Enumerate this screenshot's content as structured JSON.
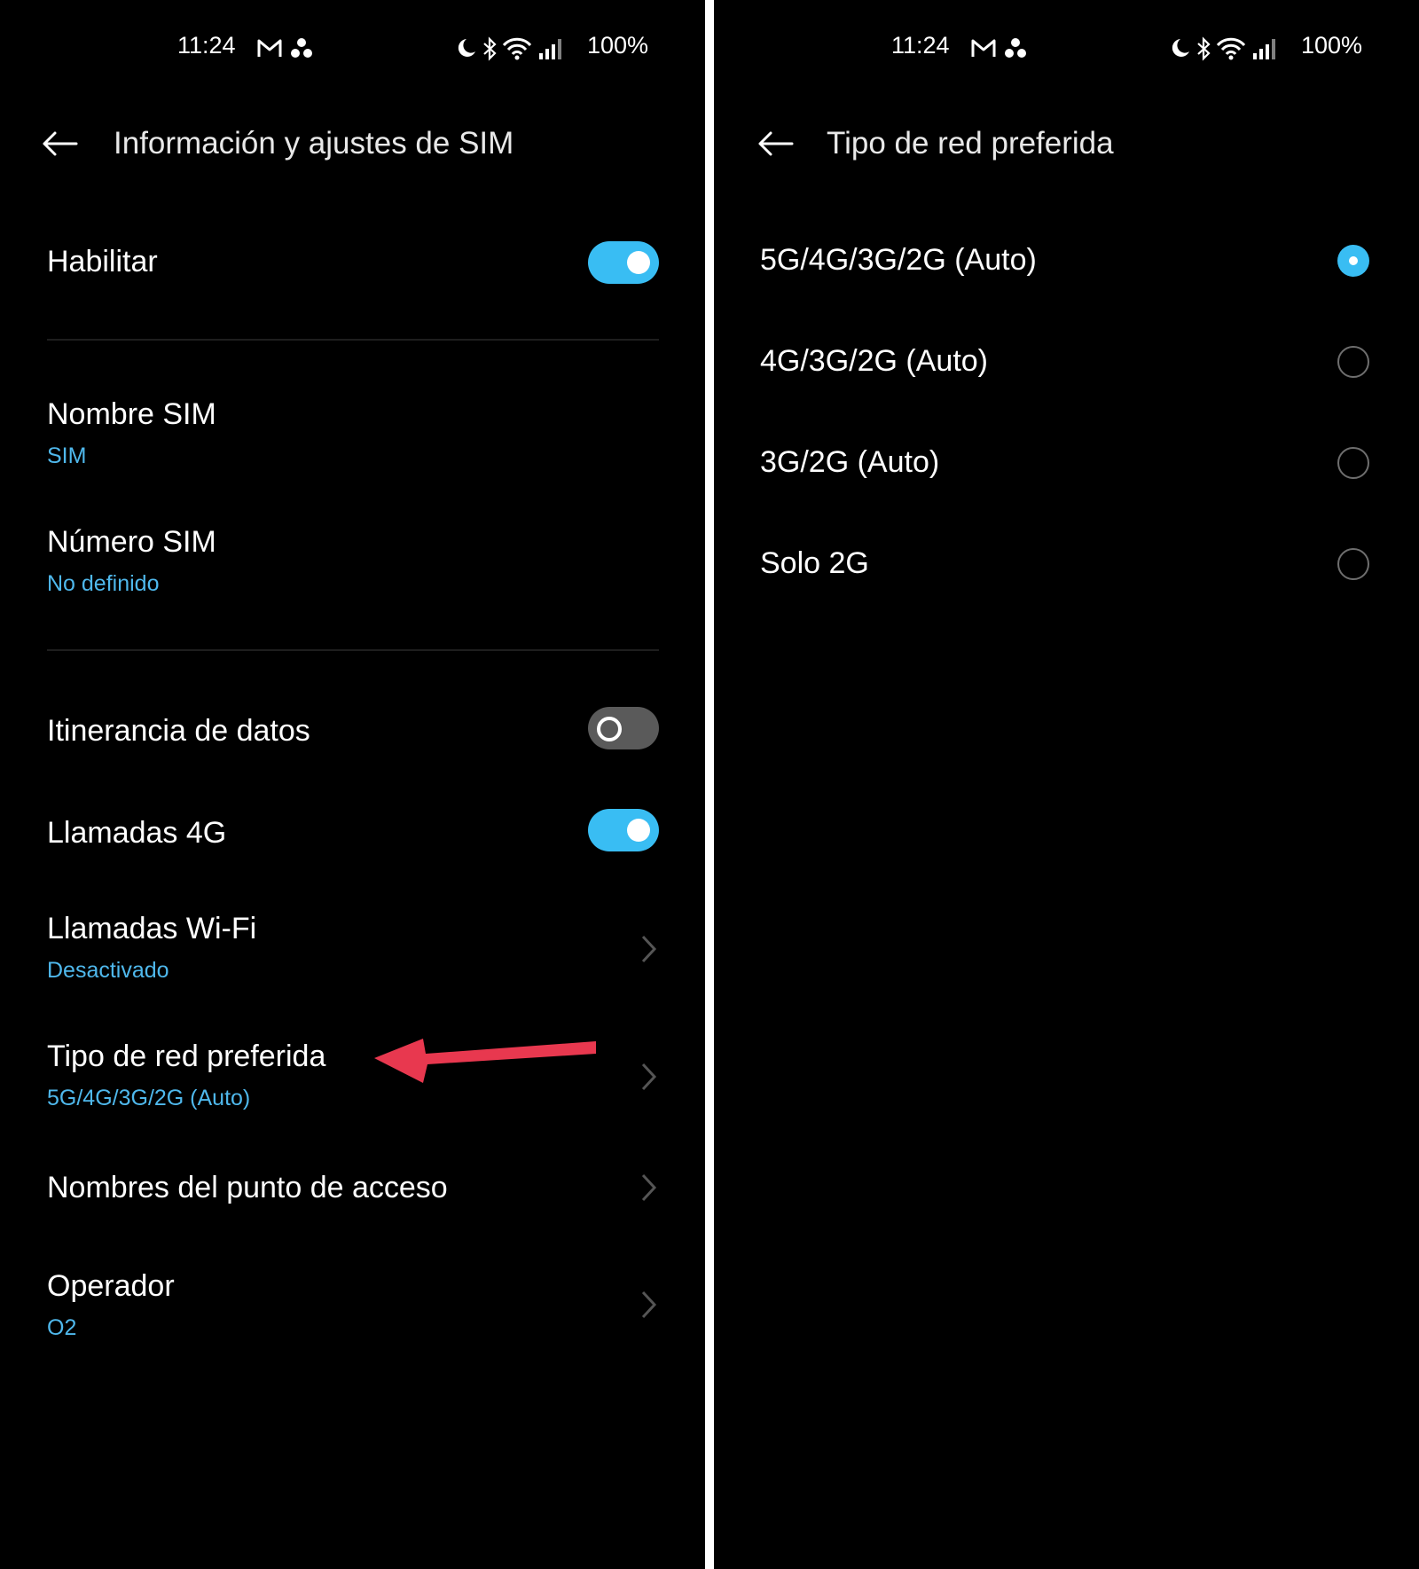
{
  "status_bar": {
    "time": "11:24",
    "battery": "100%",
    "notification_icons": [
      "gmail-icon",
      "app-cluster-icon"
    ],
    "system_icons": [
      "moon-icon",
      "bluetooth-icon",
      "wifi-icon",
      "signal-icon"
    ]
  },
  "left_screen": {
    "title": "Información y ajustes de SIM",
    "rows": {
      "habilitar": {
        "label": "Habilitar",
        "toggle": "on"
      },
      "nombre_sim": {
        "label": "Nombre SIM",
        "value": "SIM"
      },
      "numero_sim": {
        "label": "Número SIM",
        "value": "No definido"
      },
      "itinerancia": {
        "label": "Itinerancia de datos",
        "toggle": "off"
      },
      "llamadas_4g": {
        "label": "Llamadas 4G",
        "toggle": "on"
      },
      "llamadas_wifi": {
        "label": "Llamadas Wi-Fi",
        "value": "Desactivado"
      },
      "tipo_red": {
        "label": "Tipo de red preferida",
        "value": "5G/4G/3G/2G (Auto)"
      },
      "apn": {
        "label": "Nombres del punto de acceso"
      },
      "operador": {
        "label": "Operador",
        "value": "O2"
      }
    }
  },
  "right_screen": {
    "title": "Tipo de red preferida",
    "options": [
      {
        "label": "5G/4G/3G/2G (Auto)",
        "selected": true
      },
      {
        "label": "4G/3G/2G (Auto)",
        "selected": false
      },
      {
        "label": "3G/2G (Auto)",
        "selected": false
      },
      {
        "label": "Solo 2G",
        "selected": false
      }
    ]
  },
  "colors": {
    "accent": "#39bdf3",
    "subtext": "#4fb8ec",
    "annotation_arrow": "#e8384f",
    "background": "#000000"
  }
}
